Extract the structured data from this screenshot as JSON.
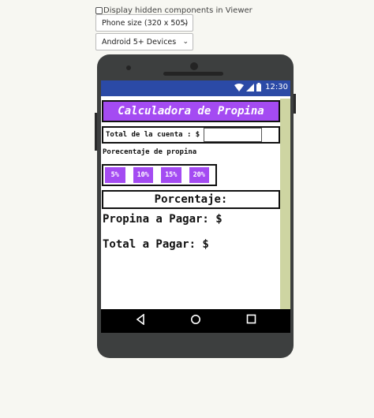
{
  "viewer_options": {
    "display_hidden_label": "Display hidden components in Viewer",
    "display_hidden_checked": false,
    "phone_size_selected": "Phone size (320 x 505)",
    "device_selected": "Android 5+ Devices"
  },
  "status_bar": {
    "time": "12:30",
    "icons": [
      "wifi-icon",
      "signal-icon",
      "battery-icon"
    ]
  },
  "app": {
    "title": "Calculadora de Propina",
    "cuenta_label": "Total de la cuenta : $",
    "cuenta_value": "",
    "porcentaje_label": "Porecentaje de propina",
    "percent_buttons": [
      "5%",
      "10%",
      "15%",
      "20%"
    ],
    "porcentaje_display": "Porcentaje:",
    "propina_text": "Propina a Pagar: $",
    "total_text": "Total a Pagar: $"
  },
  "nav": {
    "back": "back-icon",
    "home": "home-icon",
    "recent": "recent-apps-icon"
  },
  "colors": {
    "accent_purple": "#a44bf2",
    "status_bar_blue": "#2b4aa6",
    "right_panel": "#ced5a2",
    "phone_body": "#3d3f3f"
  }
}
